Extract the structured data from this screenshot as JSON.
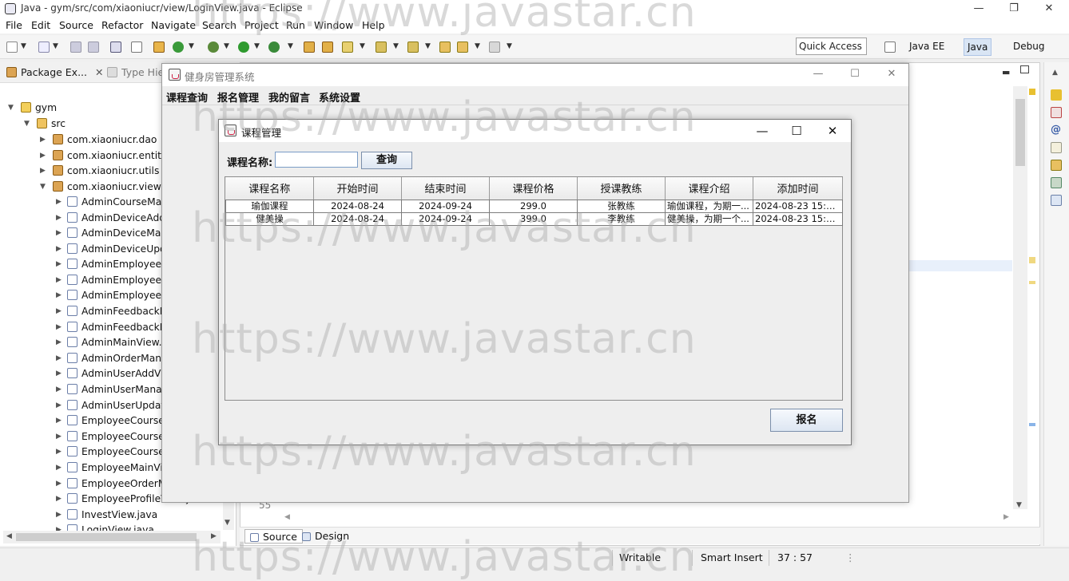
{
  "eclipse": {
    "title": "Java - gym/src/com/xiaoniucr/view/LoginView.java - Eclipse",
    "window_controls": [
      "—",
      "❐",
      "✕"
    ],
    "menu": [
      "File",
      "Edit",
      "Source",
      "Refactor",
      "Navigate",
      "Search",
      "Project",
      "Run",
      "Window",
      "Help"
    ],
    "quick_access": "Quick Access",
    "perspectives": [
      "Java EE",
      "Java",
      "Debug"
    ],
    "package_explorer_tab": "Package Ex...",
    "type_hierarchy_tab": "Type Hie",
    "tree": {
      "project": "gym",
      "src": "src",
      "packages": [
        "com.xiaoniucr.dao",
        "com.xiaoniucr.entity",
        "com.xiaoniucr.utils",
        "com.xiaoniucr.view"
      ],
      "files": [
        "AdminCourseMan",
        "AdminDeviceAdd",
        "AdminDeviceMan",
        "AdminDeviceUpd",
        "AdminEmployeeA",
        "AdminEmployeeM",
        "AdminEmployeeU",
        "AdminFeedbackM",
        "AdminFeedbackR",
        "AdminMainView.j",
        "AdminOrderMana",
        "AdminUserAddVi",
        "AdminUserManag",
        "AdminUserUpdat",
        "EmployeeCourseA",
        "EmployeeCourseI",
        "EmployeeCourseI",
        "EmployeeMainVie",
        "EmployeeOrderM",
        "EmployeeProfileView.java",
        "InvestView.java",
        "LoginView.java"
      ]
    },
    "line_number": "55",
    "bottom_tabs": [
      "Source",
      "Design"
    ],
    "status": {
      "writable": "Writable",
      "insert_mode": "Smart Insert",
      "position": "37 : 57"
    }
  },
  "app": {
    "title": "健身房管理系统",
    "menu": [
      "课程查询",
      "报名管理",
      "我的留言",
      "系统设置"
    ]
  },
  "dialog": {
    "title": "课程管理",
    "search_label": "课程名称:",
    "search_value": "",
    "search_button": "查询",
    "columns": [
      "课程名称",
      "开始时间",
      "结束时间",
      "课程价格",
      "授课教练",
      "课程介绍",
      "添加时间"
    ],
    "rows": [
      [
        "瑜伽课程",
        "2024-08-24",
        "2024-09-24",
        "299.0",
        "张教练",
        "瑜伽课程，为期一...",
        "2024-08-23 15:23..."
      ],
      [
        "健美操",
        "2024-08-24",
        "2024-09-24",
        "399.0",
        "李教练",
        "健美操，为期一个...",
        "2024-08-23 15:26..."
      ]
    ],
    "signup_button": "报名"
  },
  "watermark": "https://www.javastar.cn"
}
